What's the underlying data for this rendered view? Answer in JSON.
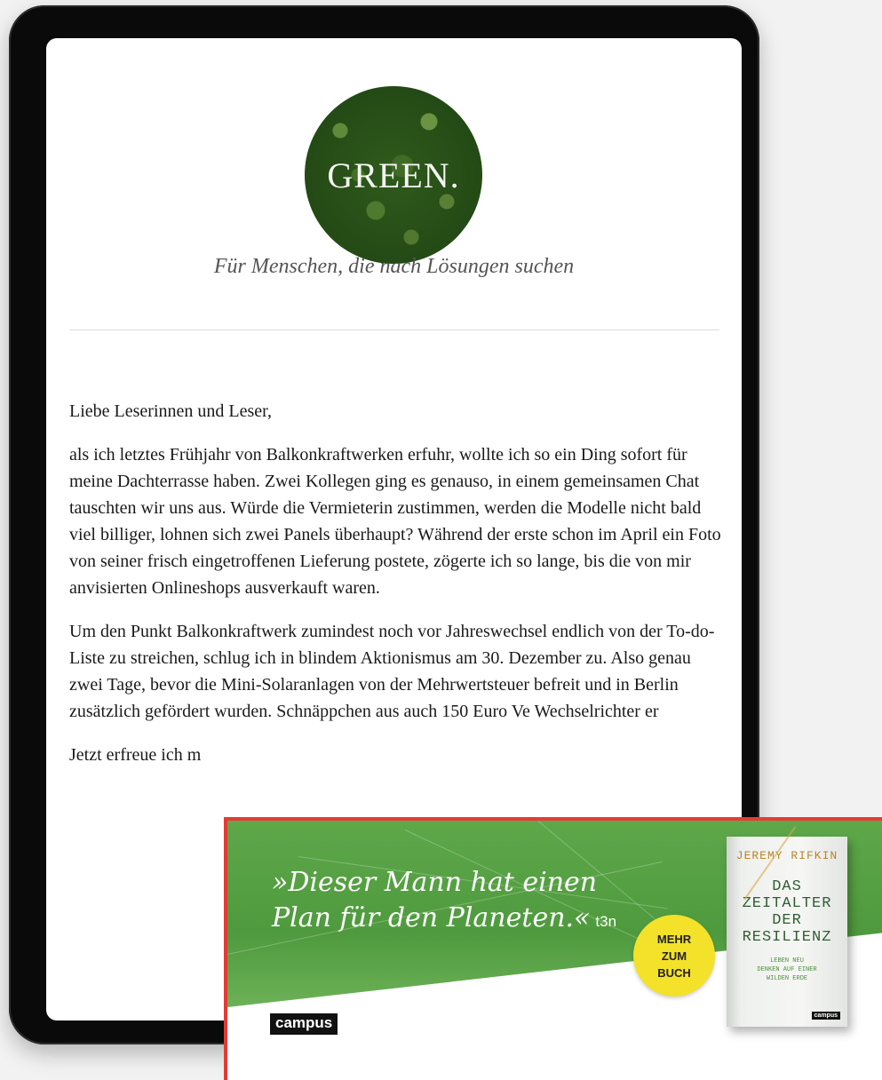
{
  "newsletter": {
    "logo_text": "GREEN.",
    "tagline": "Für Menschen, die nach Lösungen suchen",
    "paragraphs": [
      "Liebe Leserinnen und Leser,",
      "als ich letztes Frühjahr von Balkonkraftwerken erfuhr, wollte ich so ein Ding sofort für meine Dachterrasse haben. Zwei Kollegen ging es genauso, in einem gemeinsamen Chat tauschten wir uns aus. Würde die Vermieterin zustimmen, werden die Modelle nicht bald viel billiger, lohnen sich zwei Panels überhaupt? Während der erste schon im April ein Foto von seiner frisch eingetroffenen Lieferung postete, zögerte ich so lange, bis die von mir anvisierten Onlineshops ausverkauft waren.",
      "Um den Punkt Balkonkraftwerk zumindest noch vor Jahreswechsel endlich von der To-do-Liste zu streichen, schlug ich in blindem Aktionismus am 30. Dezember zu.  Also genau zwei Tage, bevor die Mini-Solaranlagen von der Mehrwertsteuer befreit und in Berlin zusätzlich gefördert wurden. Schnäppchen aus auch 150 Euro Ve Wechselrichter er",
      "Jetzt erfreue ich m"
    ]
  },
  "ad": {
    "quote_line1": "»Dieser Mann hat einen",
    "quote_line2": "Plan für den Planeten.«",
    "quote_source": "t3n",
    "badge_lines": [
      "MEHR",
      "ZUM",
      "BUCH"
    ],
    "publisher": "campus",
    "book": {
      "author": "JEREMY RIFKIN",
      "title_lines": [
        "DAS",
        "ZEITALTER",
        "DER",
        "RESILIENZ"
      ],
      "tagline_lines": [
        "LEBEN NEU",
        "DENKEN AUF EINER",
        "WILDEN ERDE"
      ],
      "publisher": "campus"
    },
    "border_color": "#e53b34",
    "accent_green": "#5ea84a",
    "badge_color": "#f4e12a"
  }
}
